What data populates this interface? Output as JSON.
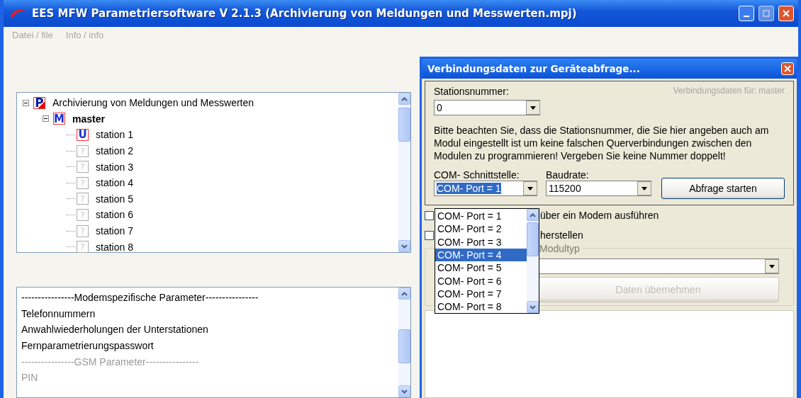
{
  "window": {
    "title": "EES MFW Parametriersoftware V 2.1.3 (Archivierung von Meldungen und Messwerten.mpj)"
  },
  "menu": [
    {
      "label": "Datei / file",
      "disabled": true
    },
    {
      "label": "Info / info",
      "disabled": true
    }
  ],
  "tree": {
    "label": "Archivierung von Meldungen und Messwerten",
    "kind": "project",
    "icon": "P",
    "expanded": true,
    "children": [
      {
        "label": "master",
        "kind": "master",
        "icon": "M",
        "expanded": true,
        "children": [
          {
            "label": "station 1",
            "kind": "station",
            "icon": "U"
          },
          {
            "label": "station 2",
            "kind": "unknown",
            "icon": "?"
          },
          {
            "label": "station 3",
            "kind": "unknown",
            "icon": "?"
          },
          {
            "label": "station 4",
            "kind": "unknown",
            "icon": "?"
          },
          {
            "label": "station 5",
            "kind": "unknown",
            "icon": "?"
          },
          {
            "label": "station 6",
            "kind": "unknown",
            "icon": "?"
          },
          {
            "label": "station 7",
            "kind": "unknown",
            "icon": "?"
          },
          {
            "label": "station 8",
            "kind": "unknown",
            "icon": "?"
          }
        ]
      }
    ]
  },
  "parameters": [
    {
      "label": "----------------Modemspezifische Parameter----------------",
      "disabled": false
    },
    {
      "label": "Telefonnummern",
      "disabled": false
    },
    {
      "label": "Anwahlwiederholungen der Unterstationen",
      "disabled": false
    },
    {
      "label": "Fernparametrierungspasswort",
      "disabled": false
    },
    {
      "label": "----------------GSM Parameter----------------",
      "disabled": true
    },
    {
      "label": "PIN",
      "disabled": true
    }
  ],
  "dialog": {
    "title": "Verbindungsdaten zur Geräteabfrage...",
    "station_label": "Stationsnummer:",
    "station_value": "0",
    "connection_for": "Verbindungsdaten für: master",
    "note": "Bitte beachten Sie, dass die Stationsnummer, die Sie hier angeben auch am Modul eingestellt ist um keine falschen Querverbindungen zwischen den Modulen zu programmieren! Vergeben Sie keine Nummer doppelt!",
    "com_label": "COM- Schnittstelle:",
    "com_value": "COM- Port = 1",
    "baud_label": "Baudrate:",
    "baud_value": "115200",
    "query_button": "Abfrage starten",
    "options": [
      {
        "label": "über ein Modem ausführen",
        "checked": false
      },
      {
        "label": "herstellen",
        "checked": false
      }
    ],
    "module_group": {
      "title": "Modultyp",
      "button": "Daten übernehmen",
      "button_disabled": true
    },
    "com_list": [
      {
        "label": "COM- Port = 1",
        "selected": false
      },
      {
        "label": "COM- Port = 2",
        "selected": false
      },
      {
        "label": "COM- Port = 3",
        "selected": false
      },
      {
        "label": "COM- Port = 4",
        "selected": true
      },
      {
        "label": "COM- Port = 5",
        "selected": false
      },
      {
        "label": "COM- Port = 6",
        "selected": false
      },
      {
        "label": "COM- Port = 7",
        "selected": false
      },
      {
        "label": "COM- Port = 8",
        "selected": false
      }
    ]
  }
}
